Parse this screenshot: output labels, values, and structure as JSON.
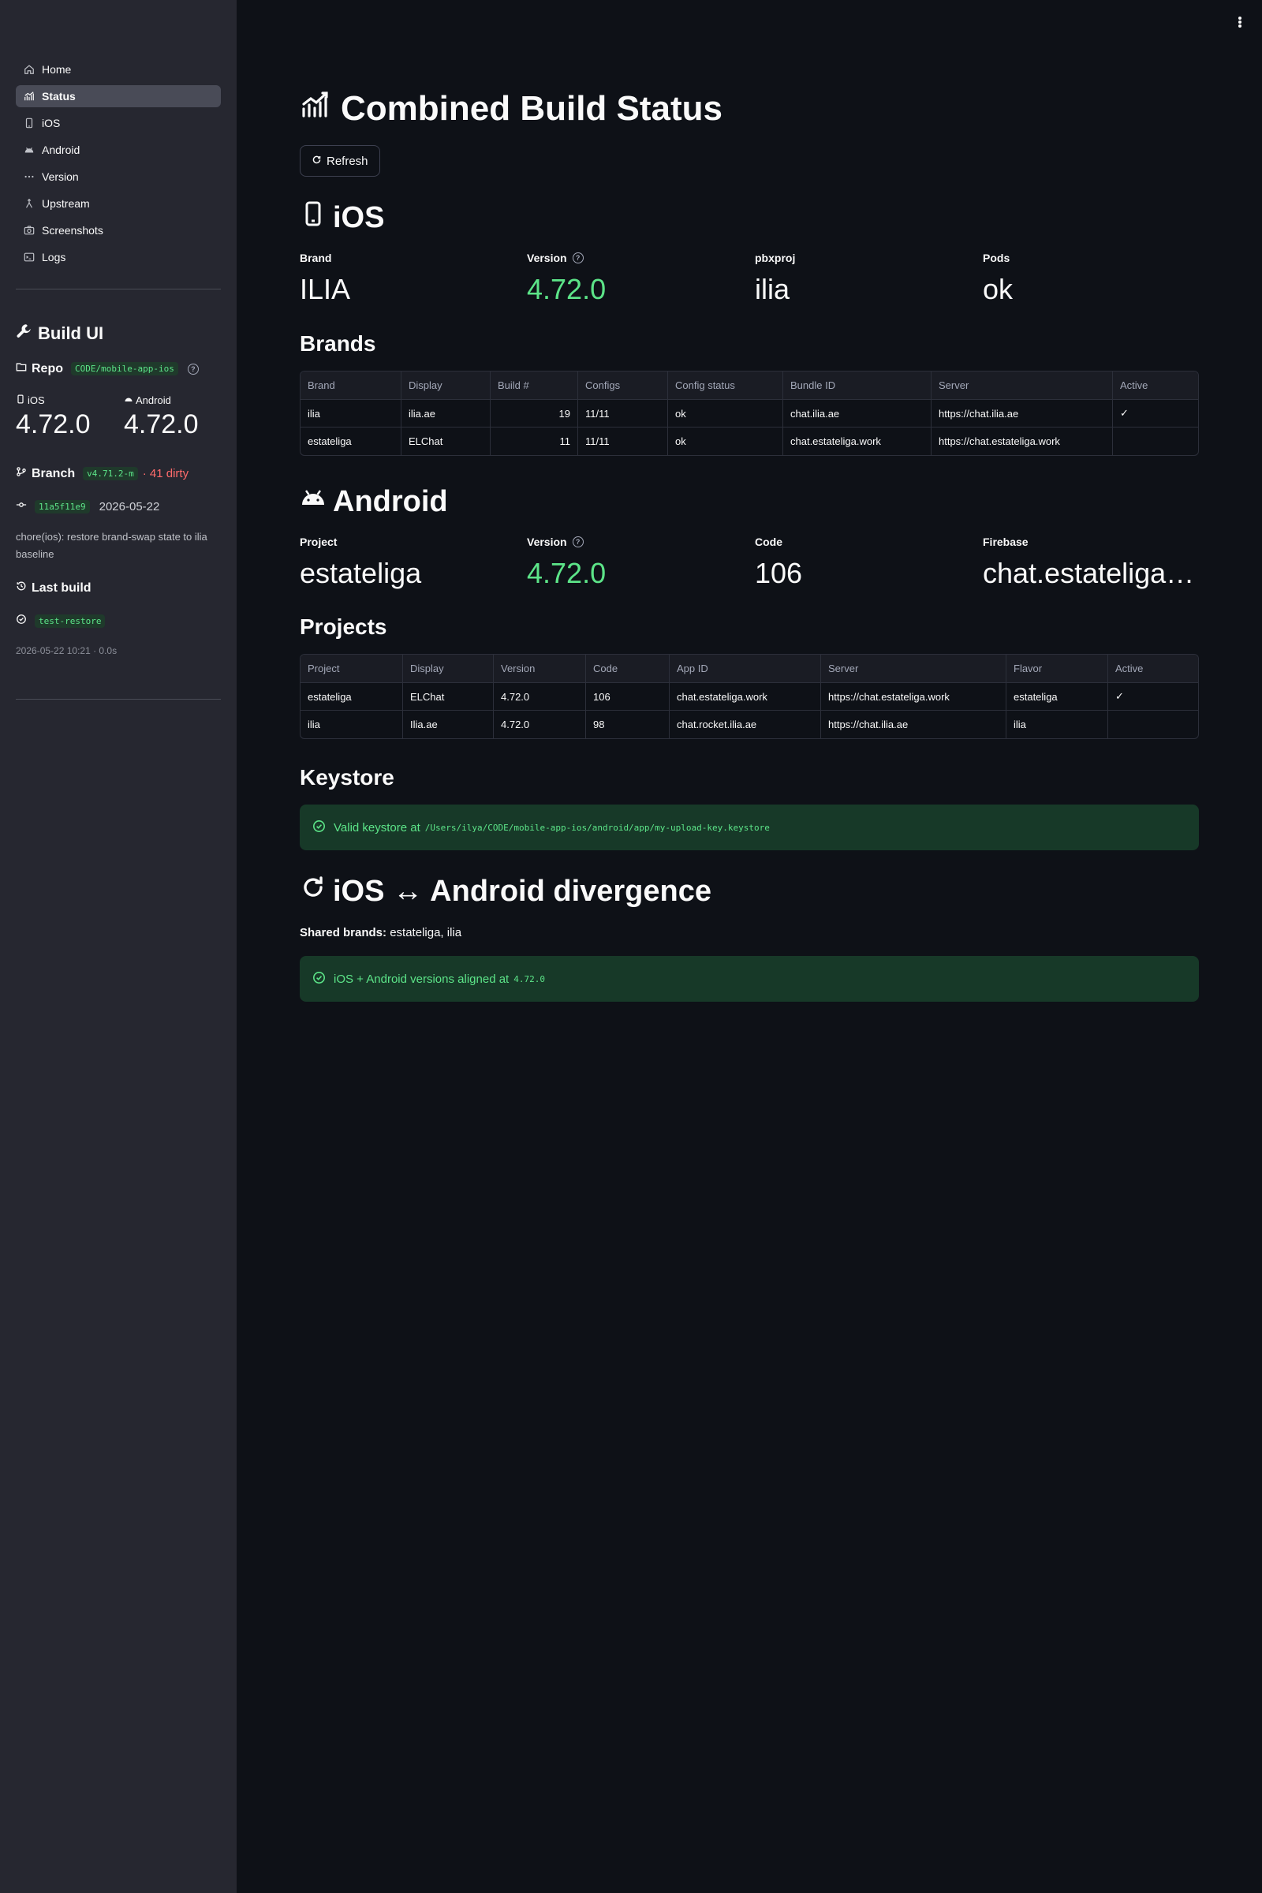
{
  "sidebar": {
    "nav": [
      {
        "label": "Home",
        "icon": "home-icon"
      },
      {
        "label": "Status",
        "icon": "chart-icon",
        "active": true
      },
      {
        "label": "iOS",
        "icon": "phone-icon"
      },
      {
        "label": "Android",
        "icon": "android-icon"
      },
      {
        "label": "Version",
        "icon": "version-icon"
      },
      {
        "label": "Upstream",
        "icon": "merge-icon"
      },
      {
        "label": "Screenshots",
        "icon": "camera-icon"
      },
      {
        "label": "Logs",
        "icon": "terminal-icon"
      }
    ],
    "title": "Build UI",
    "repo_label": "Repo",
    "repo_value": "CODE/mobile-app-ios",
    "ios_label": "iOS",
    "ios_version": "4.72.0",
    "android_label": "Android",
    "android_version": "4.72.0",
    "branch_label": "Branch",
    "branch_value": "v4.71.2-m",
    "dirty": "· 41 dirty",
    "commit_hash": "11a5f11e9",
    "commit_date": "2026-05-22",
    "commit_message": "chore(ios): restore brand-swap state to ilia baseline",
    "last_build_label": "Last build",
    "last_build_name": "test-restore",
    "last_build_meta": "2026-05-22 10:21 · 0.0s"
  },
  "main": {
    "title": "Combined Build Status",
    "refresh_label": "Refresh",
    "ios": {
      "heading": "iOS",
      "metrics": [
        {
          "label": "Brand",
          "value": "ILIA"
        },
        {
          "label": "Version",
          "value": "4.72.0",
          "help": true,
          "color": "#5ce488"
        },
        {
          "label": "pbxproj",
          "value": "ilia"
        },
        {
          "label": "Pods",
          "value": "ok"
        }
      ],
      "brands_heading": "Brands",
      "brands_table": {
        "columns": [
          "Brand",
          "Display",
          "Build #",
          "Configs",
          "Config status",
          "Bundle ID",
          "Server",
          "Active"
        ],
        "rows": [
          [
            "ilia",
            "ilia.ae",
            "19",
            "11/11",
            "ok",
            "chat.ilia.ae",
            "https://chat.ilia.ae",
            "✓"
          ],
          [
            "estateliga",
            "ELChat",
            "11",
            "11/11",
            "ok",
            "chat.estateliga.work",
            "https://chat.estateliga.work",
            ""
          ]
        ]
      }
    },
    "android": {
      "heading": "Android",
      "metrics": [
        {
          "label": "Project",
          "value": "estateliga"
        },
        {
          "label": "Version",
          "value": "4.72.0",
          "help": true,
          "color": "#5ce488"
        },
        {
          "label": "Code",
          "value": "106"
        },
        {
          "label": "Firebase",
          "value": "chat.estateliga.work"
        }
      ],
      "projects_heading": "Projects",
      "projects_table": {
        "columns": [
          "Project",
          "Display",
          "Version",
          "Code",
          "App ID",
          "Server",
          "Flavor",
          "Active"
        ],
        "rows": [
          [
            "estateliga",
            "ELChat",
            "4.72.0",
            "106",
            "chat.estateliga.work",
            "https://chat.estateliga.work",
            "estateliga",
            "✓"
          ],
          [
            "ilia",
            "Ilia.ae",
            "4.72.0",
            "98",
            "chat.rocket.ilia.ae",
            "https://chat.ilia.ae",
            "ilia",
            ""
          ]
        ]
      }
    },
    "keystore": {
      "heading": "Keystore",
      "message": "Valid keystore at",
      "path": "/Users/ilya/CODE/mobile-app-ios/android/app/my-upload-key.keystore"
    },
    "divergence": {
      "heading": "iOS ↔ Android divergence",
      "shared_label": "Shared brands:",
      "shared_value": "estateliga, ilia",
      "message": "iOS + Android versions aligned at",
      "version": "4.72.0"
    }
  }
}
